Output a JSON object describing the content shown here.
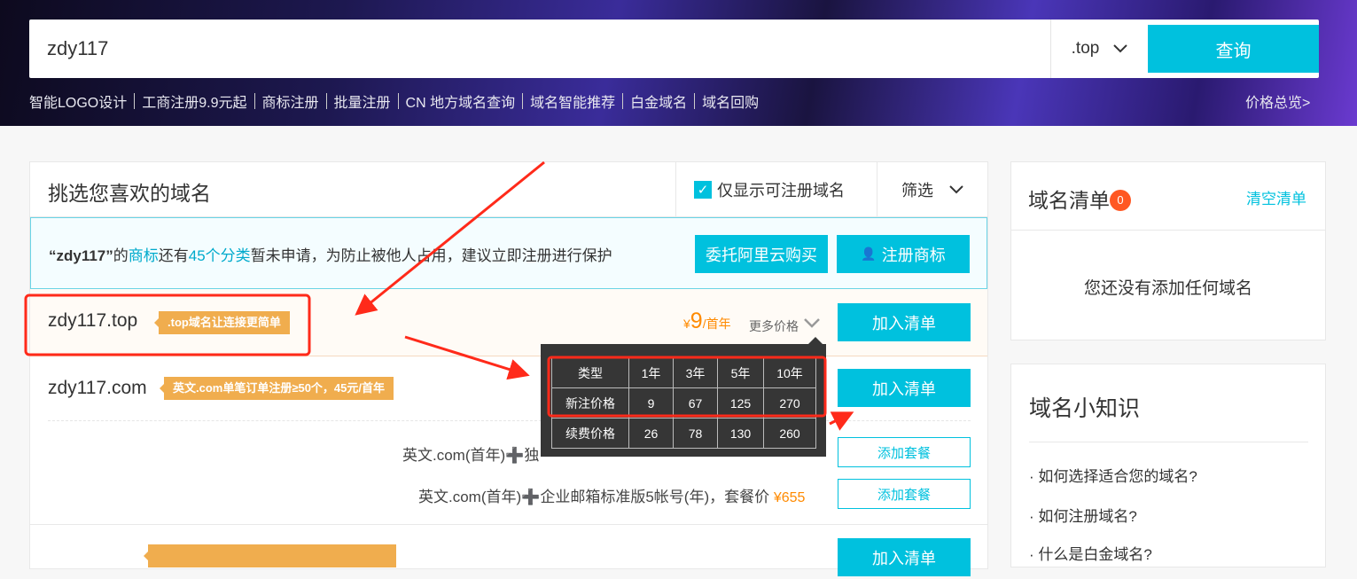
{
  "search": {
    "value": "zdy117",
    "suffix": ".top",
    "button": "查询"
  },
  "nav": {
    "links": [
      "智能LOGO设计",
      "工商注册9.9元起",
      "商标注册",
      "批量注册",
      "CN 地方域名查询",
      "域名智能推荐",
      "白金域名",
      "域名回购"
    ],
    "price_overview": "价格总览>"
  },
  "main": {
    "title": "挑选您喜欢的域名",
    "only_available": "仅显示可注册域名",
    "only_available_checked": true,
    "filter": "筛选",
    "notice": {
      "quote": "“zdy117”",
      "t1": "的",
      "trademark": "商标",
      "t2": "还有",
      "categories": "45个分类",
      "t3": "暂未申请，为防止被他人占用，建议立即注册进行保护",
      "btn_entrust": "委托阿里云购买",
      "btn_register": "注册商标"
    },
    "rows": [
      {
        "domain": "zdy117.top",
        "tag": ".top域名让连接更简单",
        "currency": "¥",
        "price": "9",
        "unit": "/首年",
        "more": "更多价格",
        "add": "加入清单"
      },
      {
        "domain": "zdy117.com",
        "tag": "英文.com单笔订单注册≥50个，45元/首年",
        "add": "加入清单",
        "packages": [
          {
            "text": "英文.com(首年)➕独",
            "add": "添加套餐"
          },
          {
            "text": "英文.com(首年)➕企业邮箱标准版5帐号(年)，套餐价",
            "price": "¥655",
            "add": "添加套餐"
          }
        ]
      },
      {
        "add": "加入清单"
      }
    ]
  },
  "price_table": {
    "header": [
      "类型",
      "1年",
      "3年",
      "5年",
      "10年"
    ],
    "rows": [
      [
        "新注价格",
        "9",
        "67",
        "125",
        "270"
      ],
      [
        "续费价格",
        "26",
        "78",
        "130",
        "260"
      ]
    ]
  },
  "cart": {
    "title": "域名清单",
    "count": "0",
    "clear": "清空清单",
    "empty": "您还没有添加任何域名"
  },
  "tips": {
    "title": "域名小知识",
    "items": [
      "· 如何选择适合您的域名?",
      "· 如何注册域名?",
      "· 什么是白金域名?"
    ]
  },
  "colors": {
    "accent": "#00c1de",
    "price": "#ff8a00",
    "tag": "#f0ad4e",
    "annotation": "#ff2a1a"
  }
}
